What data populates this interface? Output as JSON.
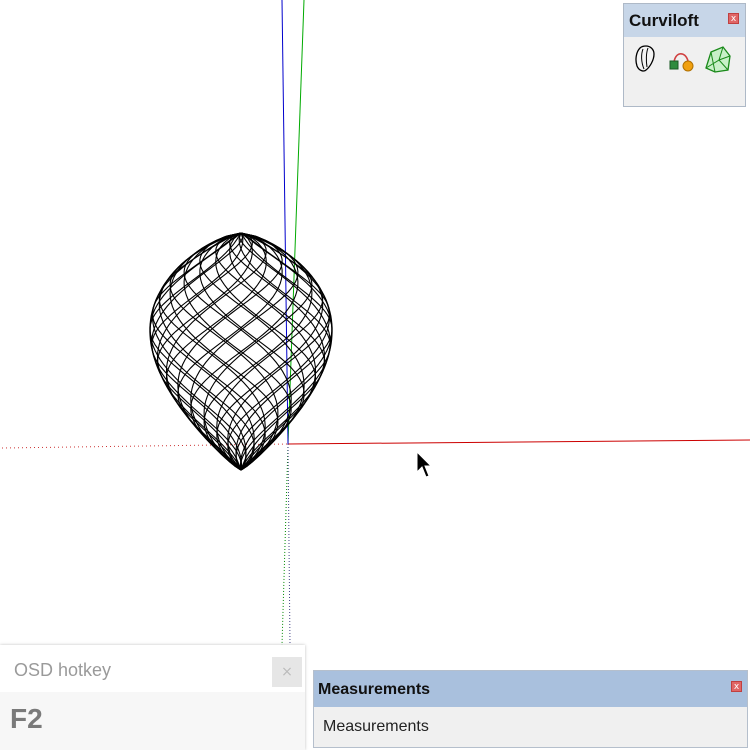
{
  "viewport": {
    "axes": {
      "red_axis_color": "#cc0000",
      "green_axis_color": "#00aa00",
      "blue_axis_color": "#0000cc"
    },
    "model_color": "#000000"
  },
  "curviloft_toolbar": {
    "title": "Curviloft",
    "close_symbol": "x",
    "tools": [
      "loft-by-spline-icon",
      "skin-contours-icon",
      "loft-along-path-icon"
    ]
  },
  "osd_hotkey": {
    "title": "OSD hotkey",
    "close_symbol": "×",
    "key": "F2"
  },
  "measurements": {
    "title": "Measurements",
    "close_symbol": "x",
    "label": "Measurements"
  }
}
